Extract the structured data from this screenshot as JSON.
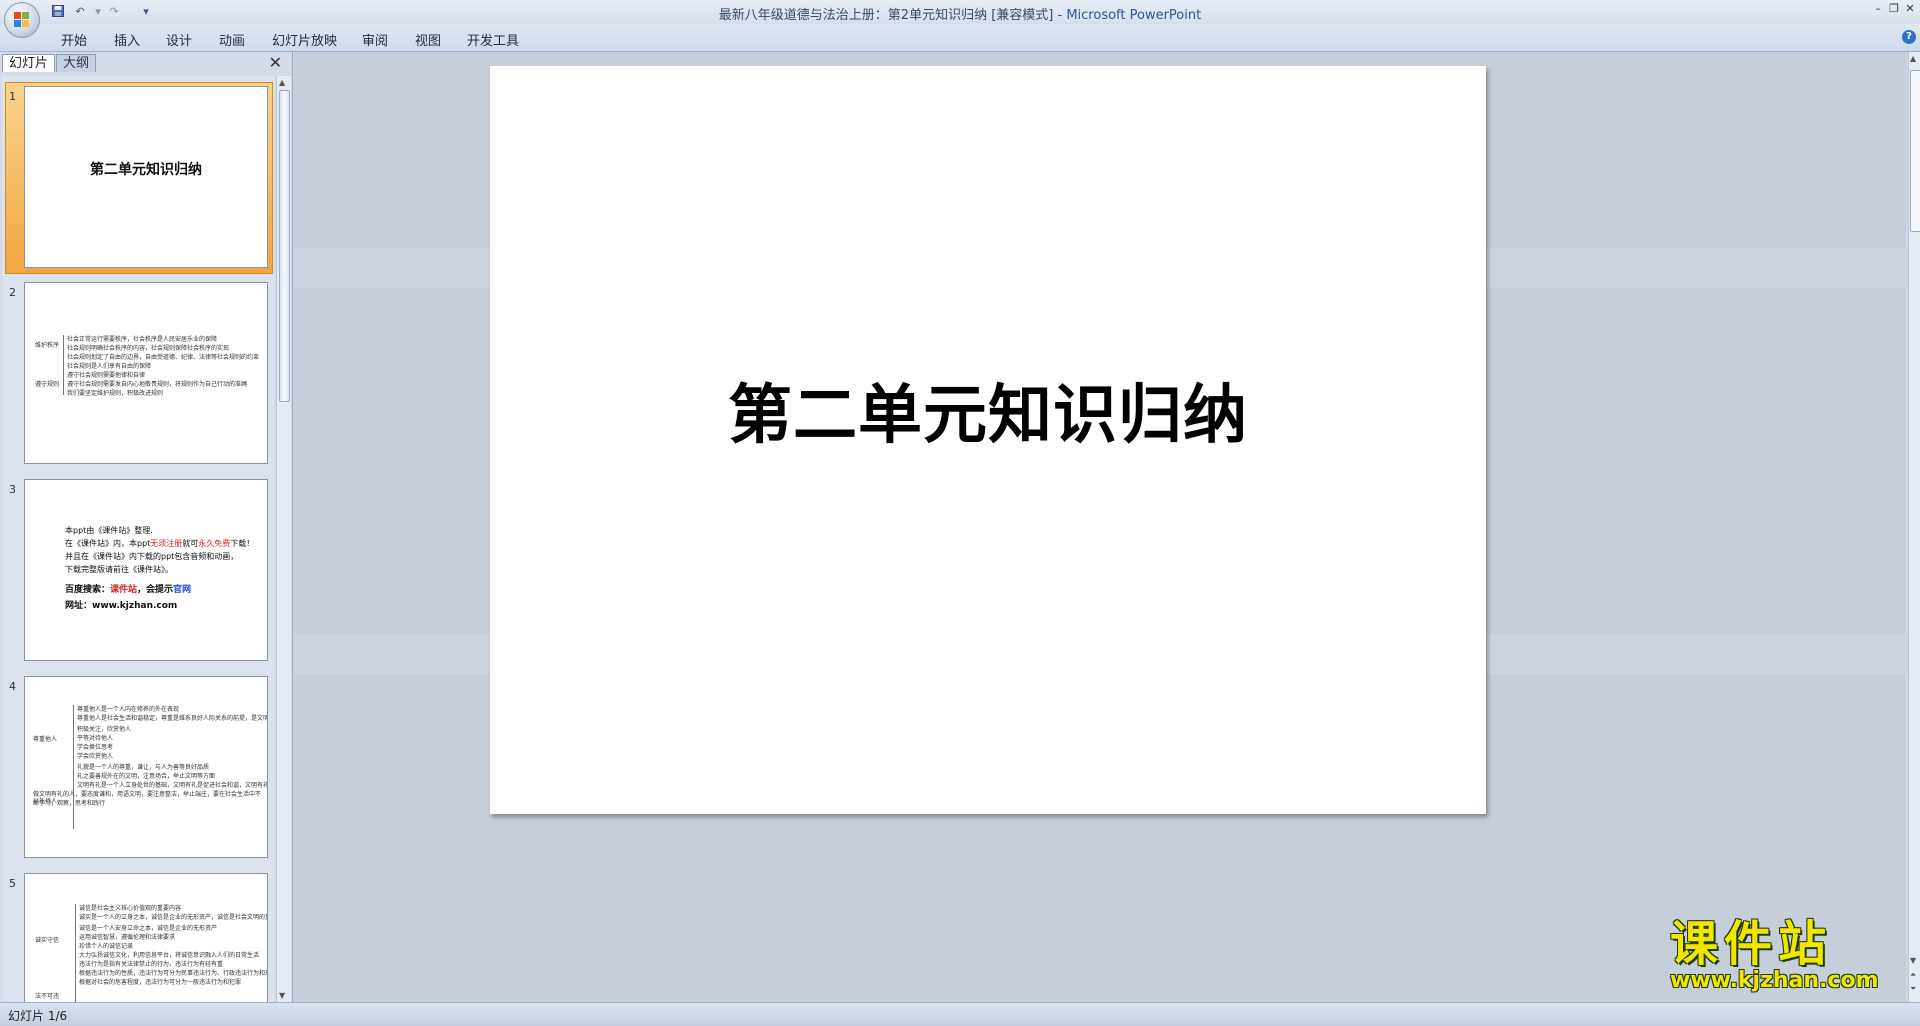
{
  "window": {
    "title": "最新八年级道德与法治上册：第2单元知识归纳 [兼容模式]",
    "app": "Microsoft PowerPoint"
  },
  "ribbon": {
    "tabs": [
      "开始",
      "插入",
      "设计",
      "动画",
      "幻灯片放映",
      "审阅",
      "视图",
      "开发工具"
    ]
  },
  "panel": {
    "tab_slides": "幻灯片",
    "tab_outline": "大纲"
  },
  "slides": [
    {
      "number": "1",
      "title": "第二单元知识归纳"
    },
    {
      "number": "2",
      "groups": [
        "维护秩序",
        "遵守规则"
      ],
      "lines": [
        "社会正常运行需要秩序，社会秩序是人民安居乐业的保障",
        "社会规则明确社会秩序的内容，社会规则保障社会秩序的实现",
        "社会规则划定了自由的边界，自由受道德、纪律、法律等社会规则的约束",
        "社会规则是人们享有自由的保障",
        "遵守社会规则需要他律和自律",
        "遵守社会规则需要发自内心地敬畏规则，将规则作为自己行动的准绳",
        "我们要坚定维护规则，积极改进规则"
      ]
    },
    {
      "number": "3",
      "l1": "本ppt由《课件站》整理.",
      "l2a": "在《课件站》内，本ppt",
      "l2b": "无须注册",
      "l2c": "就可",
      "l2d": "永久免费",
      "l2e": "下载！",
      "l3": "并且在《课件站》内下载的ppt包含音频和动画，",
      "l4": "下载完整版请前往《课件站》。",
      "l5a": "百度搜索：",
      "l5b": "课件站",
      "l5c": "，会提示",
      "l5d": "官网",
      "l6": "网址：www.kjzhan.com"
    },
    {
      "number": "4",
      "groups": [
        "尊重他人",
        "以礼待人"
      ],
      "lines": [
        "尊重他人是一个人内在修养的外在表现",
        "尊重他人是社会生活和谐稳定，尊重是维系良好人际关系的前提，是文明社会的重要特征",
        "积极关注，欣赏他人",
        "平等对待他人",
        "学会换位思考",
        "学会欣赏他人",
        "礼貌是一个人的尊重，谦让，与人为善等良好品质",
        "礼之要善规外在的文明，注意场合，举止文明等方面",
        "文明有礼是一个人立身处世的基础，文明有礼是促进社会和谐，文明有礼体现国家形象",
        "做文明有礼的人，要态度谦和，用语文明，要注意整洁，举止端庄，要在社会生活中不断学习，观察，思考和践行"
      ]
    },
    {
      "number": "5",
      "groups": [
        "诚实守信",
        "法不可违"
      ],
      "lines": [
        "诚信是社会主义核心价值观的重要内容",
        "诚实是一个人的立身之本，诚信是企业的无形资产，诚信是社会文明的重要标志",
        "诚信是一个人安身立命之本，诚信是企业的无形资产",
        "运用诚信智慧，遵循伦理和法律要求",
        "珍惜个人的诚信记录",
        "大力弘扬诚信文化，利用信息平台，将诚信意识融入人们的日常生活",
        "违法行为是指有关法律禁止的行为，违法行为有轻有重",
        "根据违法行为的性质，违法行为可分为民事违法行为、行政违法行为和刑事违法行为",
        "根据对社会的危害程度，违法行为可分为一般违法行为和犯罪"
      ]
    }
  ],
  "status": {
    "text": "幻灯片 1/6"
  },
  "watermark": {
    "main": "课件站",
    "url": "www.kjzhan.com"
  },
  "colors": {
    "accent_red": "#e02020",
    "accent_blue": "#1f4fd6",
    "selection": "#f2a640",
    "watermark": "#f2e600"
  }
}
